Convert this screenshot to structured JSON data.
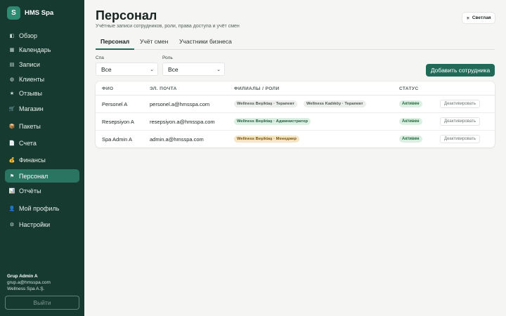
{
  "brand": {
    "logo_letter": "S",
    "name": "HMS Spa"
  },
  "sidebar": {
    "items": [
      {
        "label": "Обзор",
        "icon": "overview-icon",
        "glyph": "◧"
      },
      {
        "label": "Календарь",
        "icon": "calendar-icon",
        "glyph": "▦"
      },
      {
        "label": "Записи",
        "icon": "appointments-icon",
        "glyph": "▤"
      },
      {
        "label": "Клиенты",
        "icon": "clients-icon",
        "glyph": "◍"
      },
      {
        "label": "Отзывы",
        "icon": "star-icon",
        "glyph": "★"
      },
      {
        "label": "Магазин",
        "icon": "cart-icon",
        "glyph": "🛒"
      },
      {
        "label": "Пакеты",
        "icon": "package-icon",
        "glyph": "📦"
      },
      {
        "label": "Счета",
        "icon": "invoice-icon",
        "glyph": "📄"
      },
      {
        "label": "Финансы",
        "icon": "money-bag-icon",
        "glyph": "💰"
      },
      {
        "label": "Персонал",
        "icon": "flag-icon",
        "glyph": "⚑"
      },
      {
        "label": "Отчёты",
        "icon": "chart-icon",
        "glyph": "📊"
      },
      {
        "label": "Мой профиль",
        "icon": "user-icon",
        "glyph": "👤"
      },
      {
        "label": "Настройки",
        "icon": "gear-icon",
        "glyph": "⚙"
      }
    ],
    "active_index": 9
  },
  "user": {
    "name": "Grup Admin A",
    "email": "grup.a@hmsspa.com",
    "company": "Wellness Spa A.Ş."
  },
  "logout_label": "Выйти",
  "header": {
    "title": "Персонал",
    "subtitle": "Учётные записи сотрудников, роли, права доступа и учёт смен",
    "theme_label": "Светлая",
    "theme_glyph": "☀"
  },
  "tabs": [
    {
      "label": "Персонал"
    },
    {
      "label": "Учёт смен"
    },
    {
      "label": "Участники бизнеса"
    }
  ],
  "filters": {
    "spa": {
      "label": "Спа",
      "value": "Все"
    },
    "role": {
      "label": "Роль",
      "value": "Все"
    }
  },
  "add_button_label": "Добавить сотрудника",
  "table": {
    "columns": [
      "ФИО",
      "ЭЛ. ПОЧТА",
      "ФИЛИАЛЫ / РОЛИ",
      "СТАТУС"
    ],
    "rows": [
      {
        "name": "Personel A",
        "email": "personel.a@hmsspa.com",
        "roles": [
          "Wellness Beşiktaş · Терапевт",
          "Wellness Kadıköy · Терапевт"
        ],
        "status": "Активен",
        "action": "Деактивировать"
      },
      {
        "name": "Resepsiyon A",
        "email": "resepsiyon.a@hmsspa.com",
        "roles": [
          "Wellness Beşiktaş · Администратор"
        ],
        "status": "Активен",
        "action": "Деактивировать"
      },
      {
        "name": "Spa Admin A",
        "email": "admin.a@hmsspa.com",
        "roles": [
          "Wellness Beşiktaş · Менеджер"
        ],
        "status": "Активен",
        "action": "Деактивировать"
      }
    ]
  },
  "colors": {
    "sidebar_bg": "#173a30",
    "accent": "#1f6b58",
    "active_nav": "#2a7562",
    "status_green": "#dcefe2"
  }
}
